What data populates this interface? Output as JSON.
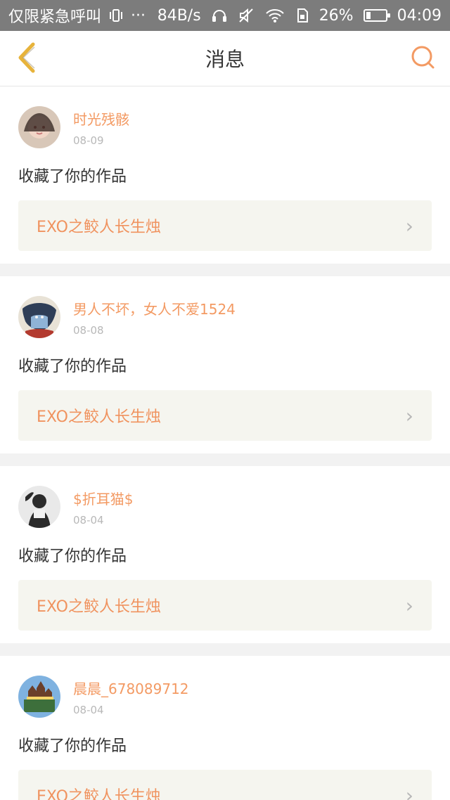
{
  "status_bar": {
    "carrier": "仅限紧急呼叫",
    "speed": "84B/s",
    "battery": "26%",
    "battery_level": 0.26,
    "time": "04:09"
  },
  "nav": {
    "title": "消息"
  },
  "messages": [
    {
      "username": "时光残骸",
      "date": "08-09",
      "action": "收藏了你的作品",
      "work_title": "EXO之鲛人长生烛"
    },
    {
      "username": "男人不坏，女人不爱1524",
      "date": "08-08",
      "action": "收藏了你的作品",
      "work_title": "EXO之鲛人长生烛"
    },
    {
      "username": "$折耳猫$",
      "date": "08-04",
      "action": "收藏了你的作品",
      "work_title": "EXO之鲛人长生烛"
    },
    {
      "username": "晨晨_678089712",
      "date": "08-04",
      "action": "收藏了你的作品",
      "work_title": "EXO之鲛人长生烛"
    }
  ],
  "colors": {
    "accent_orange": "#f39a63",
    "back_yellow": "#e7b33b"
  }
}
